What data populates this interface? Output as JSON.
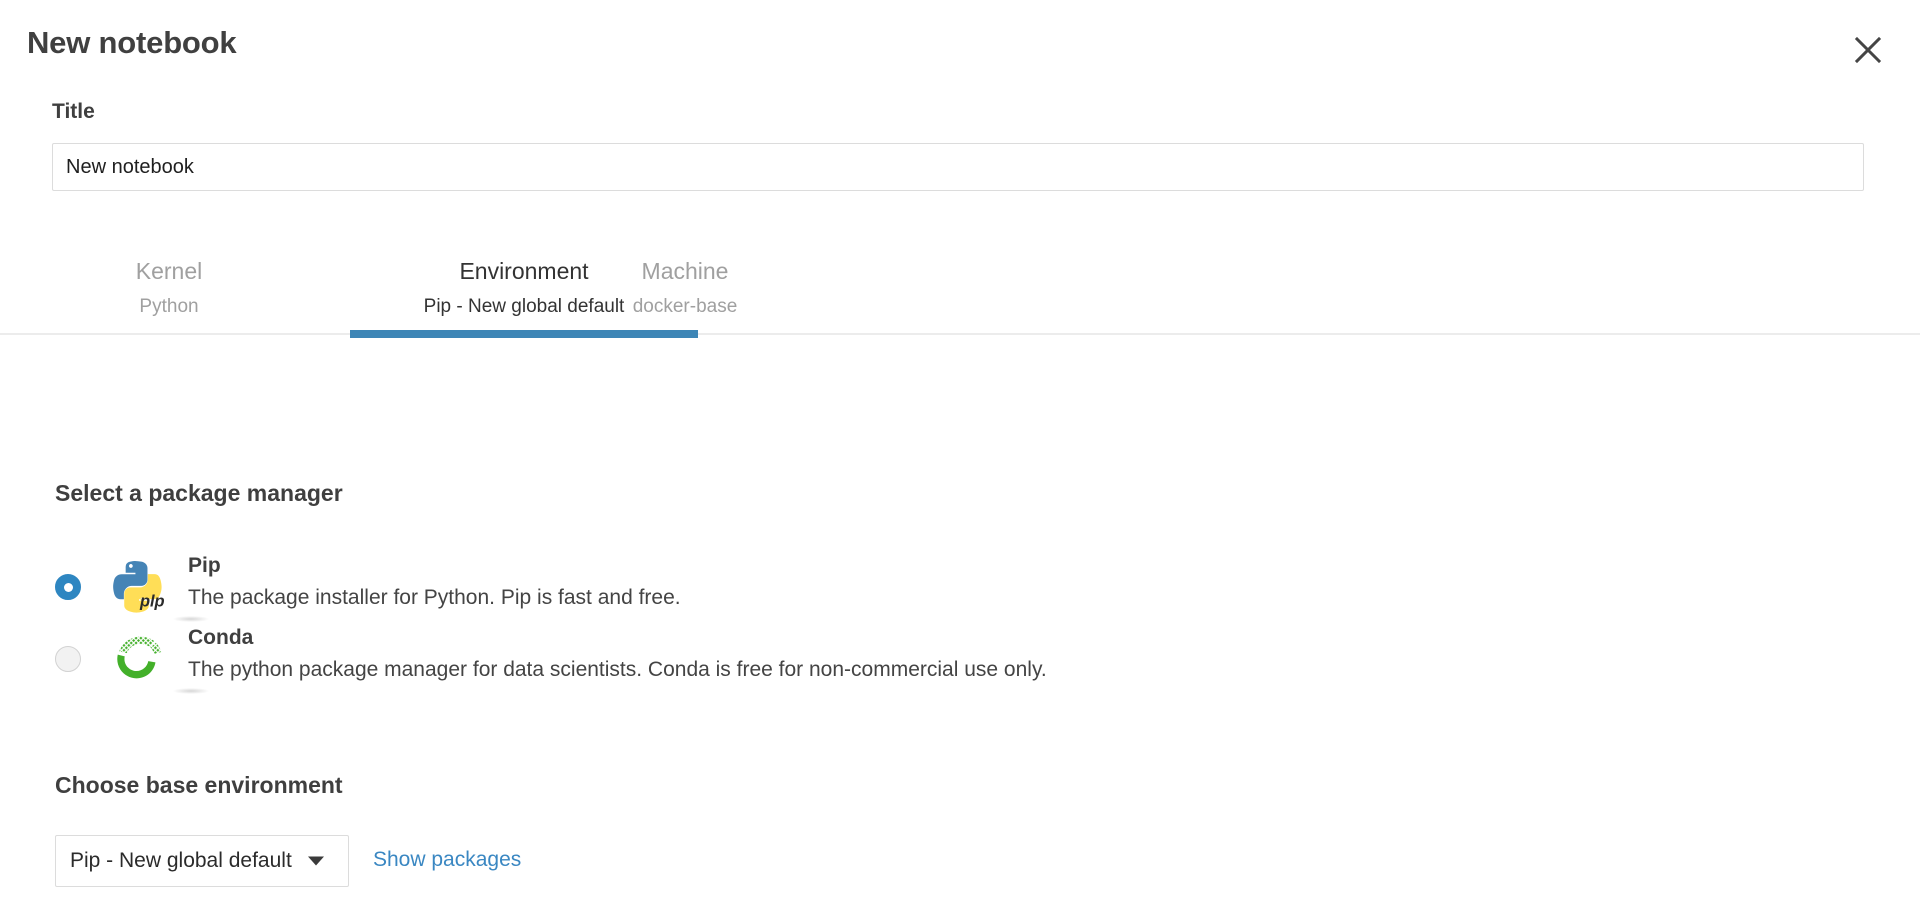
{
  "dialog": {
    "title": "New notebook",
    "close_icon": "close-icon"
  },
  "title_field": {
    "label": "Title",
    "value": "New notebook",
    "placeholder": "New notebook"
  },
  "tabs": [
    {
      "label": "Kernel",
      "sublabel": "Python",
      "active": false
    },
    {
      "label": "Environment",
      "sublabel": "Pip - New global default",
      "active": true
    },
    {
      "label": "Machine",
      "sublabel": "docker-base",
      "active": false
    }
  ],
  "package_manager": {
    "heading": "Select a package manager",
    "options": [
      {
        "name": "Pip",
        "description": "The package installer for Python. Pip is fast and free.",
        "selected": true,
        "icon": "pip-logo-icon"
      },
      {
        "name": "Conda",
        "description": "The python package manager for data scientists. Conda is free for non-commercial use only.",
        "selected": false,
        "icon": "conda-logo-icon"
      }
    ]
  },
  "base_environment": {
    "heading": "Choose base environment",
    "selected": "Pip - New global default",
    "show_packages_label": "Show packages"
  },
  "colors": {
    "accent_blue": "#3e86b6",
    "link_blue": "#3a87c2",
    "radio_selected": "#2e86c1",
    "python_blue": "#4584b6",
    "python_yellow": "#ffde57",
    "conda_green": "#43b02a",
    "text_dark": "#3f3f3f",
    "text_muted": "#a0a0a0",
    "border": "#dcdcdc"
  }
}
